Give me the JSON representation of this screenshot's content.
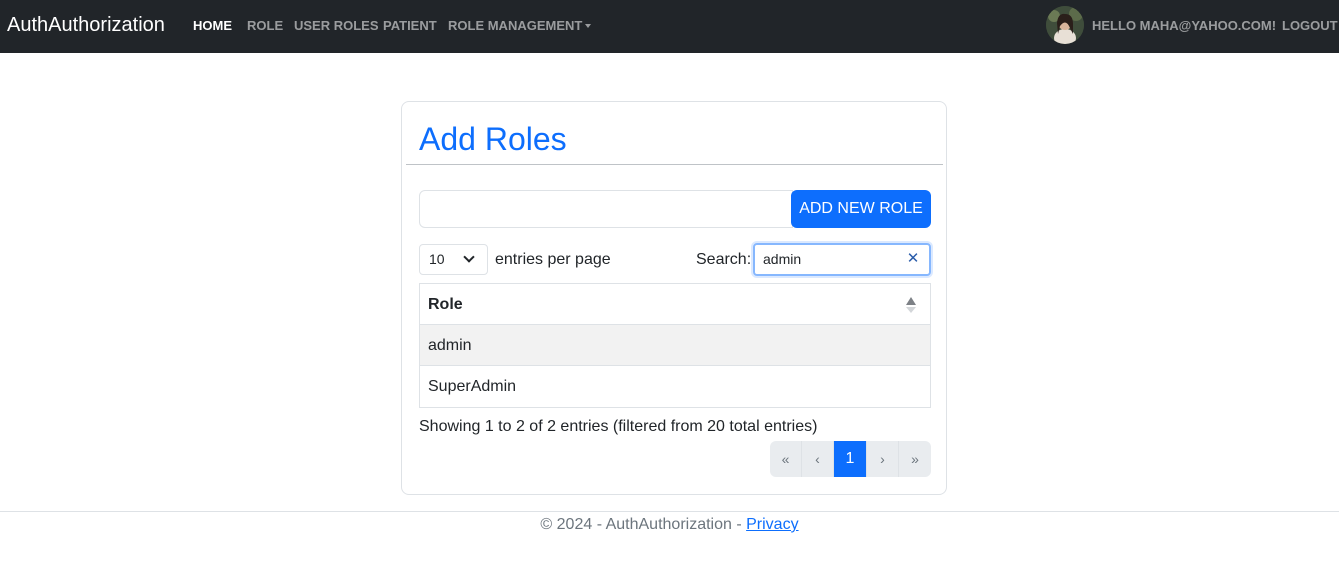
{
  "navbar": {
    "brand": "AuthAuthorization",
    "items": [
      {
        "label": "HOME"
      },
      {
        "label": "ROLE"
      },
      {
        "label": "USER ROLES"
      },
      {
        "label": "PATIENT"
      },
      {
        "label": "ROLE MANAGEMENT"
      }
    ],
    "greeting": "HELLO MAHA@YAHOO.COM!",
    "logout": "LOGOUT"
  },
  "card": {
    "title": "Add Roles",
    "role_input_value": "",
    "add_button": "ADD NEW ROLE",
    "per_page_value": "10",
    "per_page_label": "entries per page",
    "search_label": "Search:",
    "search_value": "admin",
    "table": {
      "header": "Role",
      "rows": [
        "admin",
        "SuperAdmin"
      ]
    },
    "info": "Showing 1 to 2 of 2 entries (filtered from 20 total entries)",
    "pagination": {
      "first": "«",
      "prev": "‹",
      "current": "1",
      "next": "›",
      "last": "»"
    }
  },
  "footer": {
    "text": "© 2024 - AuthAuthorization - ",
    "link": "Privacy"
  },
  "colors": {
    "navbar": "#212529",
    "primary": "#0d6efd"
  }
}
